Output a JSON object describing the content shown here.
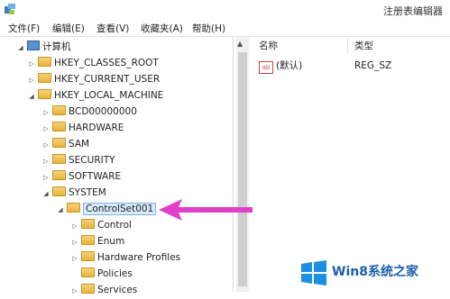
{
  "window": {
    "title": "注册表编辑器"
  },
  "menu": [
    "文件(F)",
    "编辑(E)",
    "查看(V)",
    "收藏夹(A)",
    "帮助(H)"
  ],
  "tree": {
    "root": "计算机",
    "hives": [
      "HKEY_CLASSES_ROOT",
      "HKEY_CURRENT_USER",
      "HKEY_LOCAL_MACHINE"
    ],
    "hklm_children": [
      "BCD00000000",
      "HARDWARE",
      "SAM",
      "SECURITY",
      "SOFTWARE",
      "SYSTEM"
    ],
    "system_children": [
      "ControlSet001"
    ],
    "controlset_children": [
      "Control",
      "Enum",
      "Hardware Profiles",
      "Policies",
      "Services"
    ],
    "selected": "ControlSet001"
  },
  "list": {
    "columns": [
      "名称",
      "类型"
    ],
    "rows": [
      {
        "name": "(默认)",
        "type": "REG_SZ"
      }
    ]
  },
  "logo": {
    "text": "Win8系统之家"
  },
  "colors": {
    "arrow": "#e040c8",
    "selection": "#d9ebfb",
    "accent": "#1a5fa8"
  },
  "icons": {
    "folder": "folder-icon",
    "computer": "computer-icon",
    "string_value": "reg-sz-icon"
  }
}
